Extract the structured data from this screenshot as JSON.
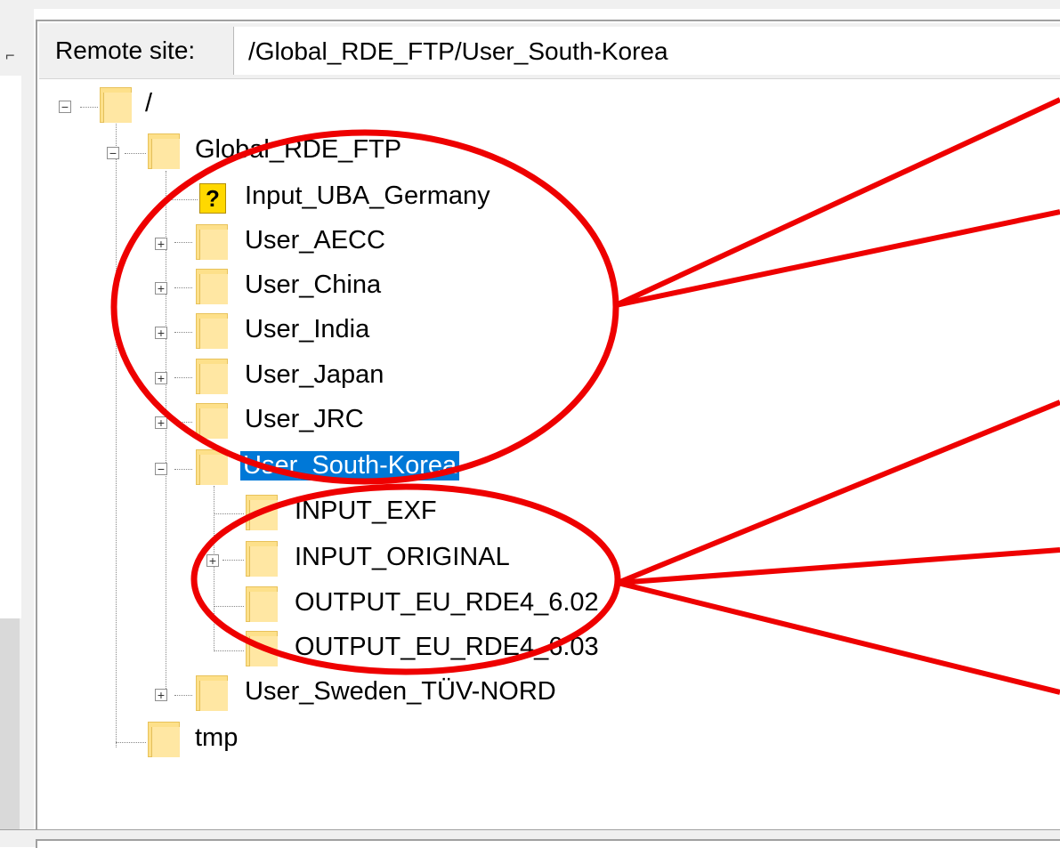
{
  "address_bar": {
    "label": "Remote site:",
    "path": "/Global_RDE_FTP/User_South-Korea"
  },
  "tree": {
    "root": {
      "label": "/",
      "expander": "−"
    },
    "global": {
      "label": "Global_RDE_FTP",
      "expander": "−"
    },
    "items": [
      {
        "label": "Input_UBA_Germany",
        "icon": "unknown-folder-icon",
        "expander": ""
      },
      {
        "label": "User_AECC",
        "expander": "+"
      },
      {
        "label": "User_China",
        "expander": "+"
      },
      {
        "label": "User_India",
        "expander": "+"
      },
      {
        "label": "User_Japan",
        "expander": "+"
      },
      {
        "label": "User_JRC",
        "expander": "+"
      },
      {
        "label": "User_South-Korea",
        "expander": "−",
        "selected": true
      },
      {
        "label": "User_Sweden_TÜV-NORD",
        "expander": "+"
      }
    ],
    "korea_children": [
      {
        "label": "INPUT_EXF",
        "expander": ""
      },
      {
        "label": "INPUT_ORIGINAL",
        "expander": "+"
      },
      {
        "label": "OUTPUT_EU_RDE4_6.02",
        "expander": ""
      },
      {
        "label": "OUTPUT_EU_RDE4_6.03",
        "expander": ""
      }
    ],
    "tmp": {
      "label": "tmp"
    },
    "unknown_glyph": "?"
  },
  "colors": {
    "selection": "#0078d7",
    "annotation": "#ee0000",
    "folder": "#fde08a"
  }
}
